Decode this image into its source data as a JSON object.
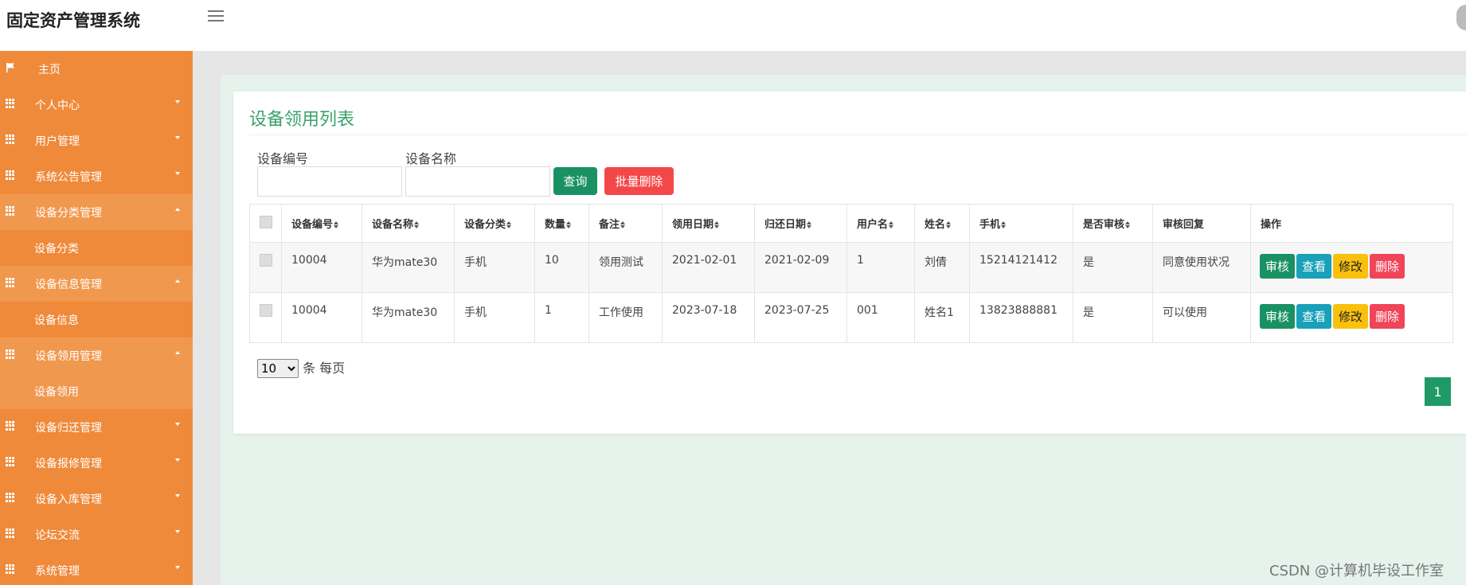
{
  "app": {
    "title": "固定资产管理系统"
  },
  "sidebar": {
    "items": [
      {
        "label": "主页",
        "icon": "flag-icon",
        "type": "home"
      },
      {
        "label": "个人中心",
        "icon": "grid-icon",
        "open": false
      },
      {
        "label": "用户管理",
        "icon": "grid-icon",
        "open": false
      },
      {
        "label": "系统公告管理",
        "icon": "grid-icon",
        "open": false
      },
      {
        "label": "设备分类管理",
        "icon": "grid-icon",
        "open": true,
        "sub": "设备分类"
      },
      {
        "label": "设备信息管理",
        "icon": "grid-icon",
        "open": true,
        "sub": "设备信息"
      },
      {
        "label": "设备领用管理",
        "icon": "grid-icon",
        "open": true,
        "sub": "设备领用"
      },
      {
        "label": "设备归还管理",
        "icon": "grid-icon",
        "open": false
      },
      {
        "label": "设备报修管理",
        "icon": "grid-icon",
        "open": false
      },
      {
        "label": "设备入库管理",
        "icon": "grid-icon",
        "open": false
      },
      {
        "label": "论坛交流",
        "icon": "grid-icon",
        "open": false
      },
      {
        "label": "系统管理",
        "icon": "grid-icon",
        "open": false
      }
    ]
  },
  "main": {
    "title": "设备领用列表",
    "search": {
      "code_label": "设备编号",
      "code_value": "",
      "name_label": "设备名称",
      "name_value": "",
      "query_button": "查询",
      "batch_delete_button": "批量删除"
    },
    "table": {
      "columns": [
        "设备编号",
        "设备名称",
        "设备分类",
        "数量",
        "备注",
        "领用日期",
        "归还日期",
        "用户名",
        "姓名",
        "手机",
        "是否审核",
        "审核回复",
        "操作"
      ],
      "rows": [
        [
          "10004",
          "华为mate30",
          "手机",
          "10",
          "领用测试",
          "2021-02-01",
          "2021-02-09",
          "1",
          "刘倩",
          "15214121412",
          "是",
          "同意使用状况"
        ],
        [
          "10004",
          "华为mate30",
          "手机",
          "1",
          "工作使用",
          "2023-07-18",
          "2023-07-25",
          "001",
          "姓名1",
          "13823888881",
          "是",
          "可以使用"
        ]
      ],
      "actions": [
        "审核",
        "查看",
        "修改",
        "删除"
      ]
    },
    "pagination": {
      "page_size": "10",
      "page_size_suffix": "条 每页",
      "current_page": "1"
    }
  },
  "watermark": "CSDN @计算机毕设工作室",
  "colors": {
    "sidebar": "#ef8a3b",
    "accent": "#3aa36a",
    "primary_button": "#199164",
    "danger_button": "#f44748"
  }
}
